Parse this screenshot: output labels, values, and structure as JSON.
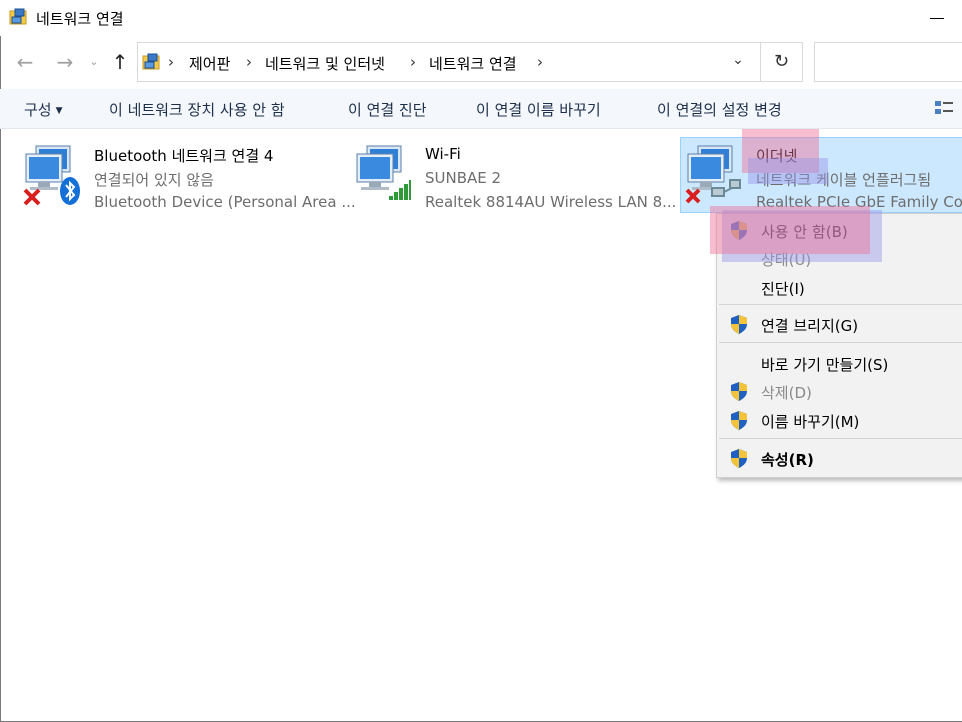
{
  "window": {
    "title": "네트워크 연결"
  },
  "address": {
    "crumbs": [
      "제어판",
      "네트워크 및 인터넷",
      "네트워크 연결"
    ]
  },
  "commands": {
    "organize": "구성",
    "disable": "이 네트워크 장치 사용 안 함",
    "diagnose": "이 연결 진단",
    "rename": "이 연결 이름 바꾸기",
    "settings": "이 연결의 설정 변경"
  },
  "connections": [
    {
      "name": "Bluetooth 네트워크 연결 4",
      "status": "연결되어 있지 않음",
      "device": "Bluetooth Device (Personal Area ..."
    },
    {
      "name": "Wi-Fi",
      "status": "SUNBAE 2",
      "device": "Realtek 8814AU Wireless LAN 8..."
    },
    {
      "name": "이더넷",
      "status": "네트워크 케이블 언플러그됨",
      "device": "Realtek PCIe GbE Family Cont"
    }
  ],
  "context_menu": {
    "items": [
      {
        "label": "사용 안 함(B)"
      },
      {
        "label": "상태(U)"
      },
      {
        "label": "진단(I)"
      },
      {
        "label": "연결 브리지(G)"
      },
      {
        "label": "바로 가기 만들기(S)"
      },
      {
        "label": "삭제(D)"
      },
      {
        "label": "이름 바꾸기(M)"
      },
      {
        "label": "속성(R)"
      }
    ]
  },
  "colors": {
    "selection": "#cce8ff",
    "command_bar": "#f4f7fc",
    "menu_bg": "#f2f2f2",
    "highlight_pink": "#f06e96",
    "highlight_blue": "#9696e6"
  }
}
